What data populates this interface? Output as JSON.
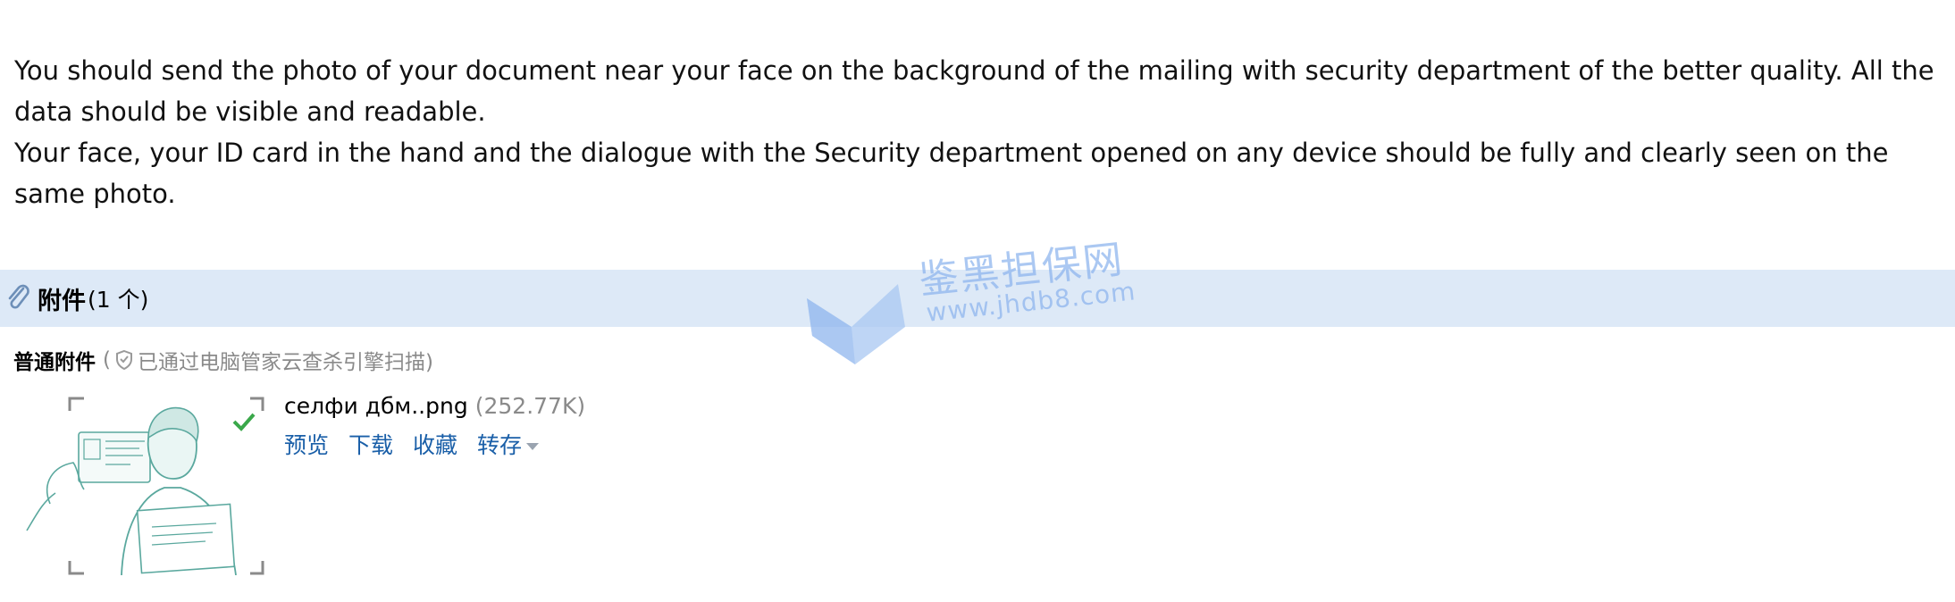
{
  "message": {
    "line1": "You should send the photo of your document near your face on the background of the mailing with security department of the better quality. All the data should be visible and readable.",
    "line2": "Your face, your ID card in the hand and the dialogue with the Security department opened on any device should be fully and clearly seen on the same photo."
  },
  "attachments": {
    "title": "附件",
    "count": "(1 个)",
    "normal_title": "普通附件",
    "scan_open": "(",
    "scan_note": "已通过电脑管家云查杀引擎扫描)",
    "file": {
      "name": "селфи дбм..png",
      "size": "(252.77K)",
      "actions": {
        "preview": "预览",
        "download": "下载",
        "favorite": "收藏",
        "save_to": "转存"
      }
    }
  },
  "watermark": {
    "text": "鉴黑担保网",
    "url": "www.jhdb8.com"
  },
  "colors": {
    "attach_bar": "#dde9f7",
    "link": "#1a5fa8",
    "muted": "#8a8a8a",
    "watermark": "#8fb6ee"
  },
  "icons": [
    "paperclip-icon",
    "shield-check-icon",
    "caret-down-icon",
    "watermark-logo-icon",
    "check-icon"
  ]
}
